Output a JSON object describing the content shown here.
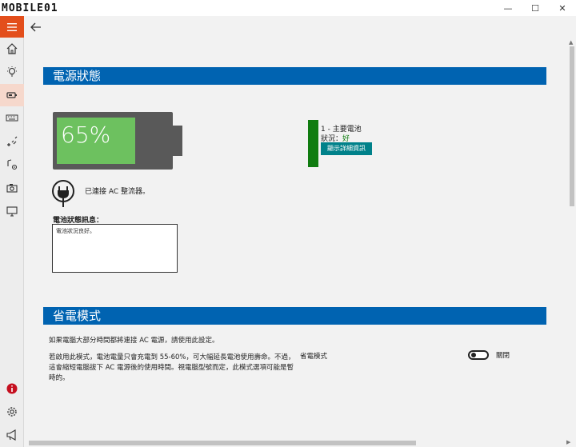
{
  "titlebar": {
    "logo_text": "MOBILE01",
    "minimize": "—",
    "maximize": "☐",
    "close": "✕"
  },
  "sidebar": {
    "items": [
      {
        "icon": "home-icon"
      },
      {
        "icon": "light-bulb-icon"
      },
      {
        "icon": "battery-icon",
        "active": true
      },
      {
        "icon": "keyboard-icon"
      },
      {
        "icon": "network-icon"
      },
      {
        "icon": "audio-settings-icon"
      },
      {
        "icon": "camera-icon"
      },
      {
        "icon": "monitor-icon"
      }
    ],
    "bottom": [
      {
        "icon": "info-icon",
        "color": "#c50f1f"
      },
      {
        "icon": "gear-icon"
      },
      {
        "icon": "megaphone-icon"
      }
    ]
  },
  "power_status": {
    "title": "電源狀態",
    "battery_percent": "65%",
    "battery_level": 0.65,
    "ac_connected": "已連接 AC 整流器。",
    "message_label": "電池狀態訊息：",
    "message": "電池狀況良好。",
    "battery_name": "1 - 主要電池",
    "status_prefix": "狀況：",
    "status_value": "好",
    "details_button": "顯示詳細資訊"
  },
  "power_saving": {
    "title": "省電模式",
    "intro": "如果電腦大部分時間都將連接 AC 電源，請使用此設定。",
    "description": "若啟用此模式，電池電量只會充電到 55-60%，可大幅延長電池使用壽命。不過，這會縮短電腦拔下 AC 電源後的使用時間。視電腦型號而定，此模式選項可能是暫時的。",
    "toggle_label": "省電模式",
    "toggle_state": "關閉"
  },
  "colors": {
    "accent_orange": "#e34e1b",
    "header_blue": "#0063b1",
    "battery_green": "#6dc15f",
    "status_green": "#107c10",
    "button_teal": "#00818a"
  }
}
